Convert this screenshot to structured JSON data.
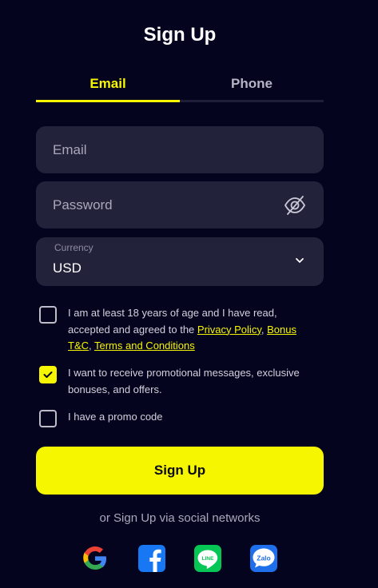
{
  "header": {
    "title": "Sign Up"
  },
  "tabs": [
    {
      "label": "Email",
      "active": true
    },
    {
      "label": "Phone",
      "active": false
    }
  ],
  "form": {
    "email": {
      "placeholder": "Email",
      "value": ""
    },
    "password": {
      "placeholder": "Password",
      "value": ""
    },
    "currency": {
      "label": "Currency",
      "value": "USD"
    }
  },
  "checkboxes": {
    "age": {
      "checked": false,
      "text_before": "I am at least 18 years of age and I have read, accepted and agreed to the ",
      "link1": "Privacy Policy",
      "sep1": ", ",
      "link2": "Bonus T&C",
      "sep2": ", ",
      "link3": "Terms and Conditions"
    },
    "promo_messages": {
      "checked": true,
      "text": "I want to receive promotional messages, exclusive bonuses, and offers."
    },
    "promo_code": {
      "checked": false,
      "text": "I have a promo code"
    }
  },
  "actions": {
    "signup_label": "Sign Up"
  },
  "social": {
    "caption": "or Sign Up via social networks",
    "line_text": "LINE",
    "zalo_text": "Zalo",
    "icons": [
      "google-icon",
      "facebook-icon",
      "line-icon",
      "zalo-icon"
    ]
  },
  "colors": {
    "background": "#05041f",
    "accent": "#f6f600",
    "field": "#23223b"
  }
}
